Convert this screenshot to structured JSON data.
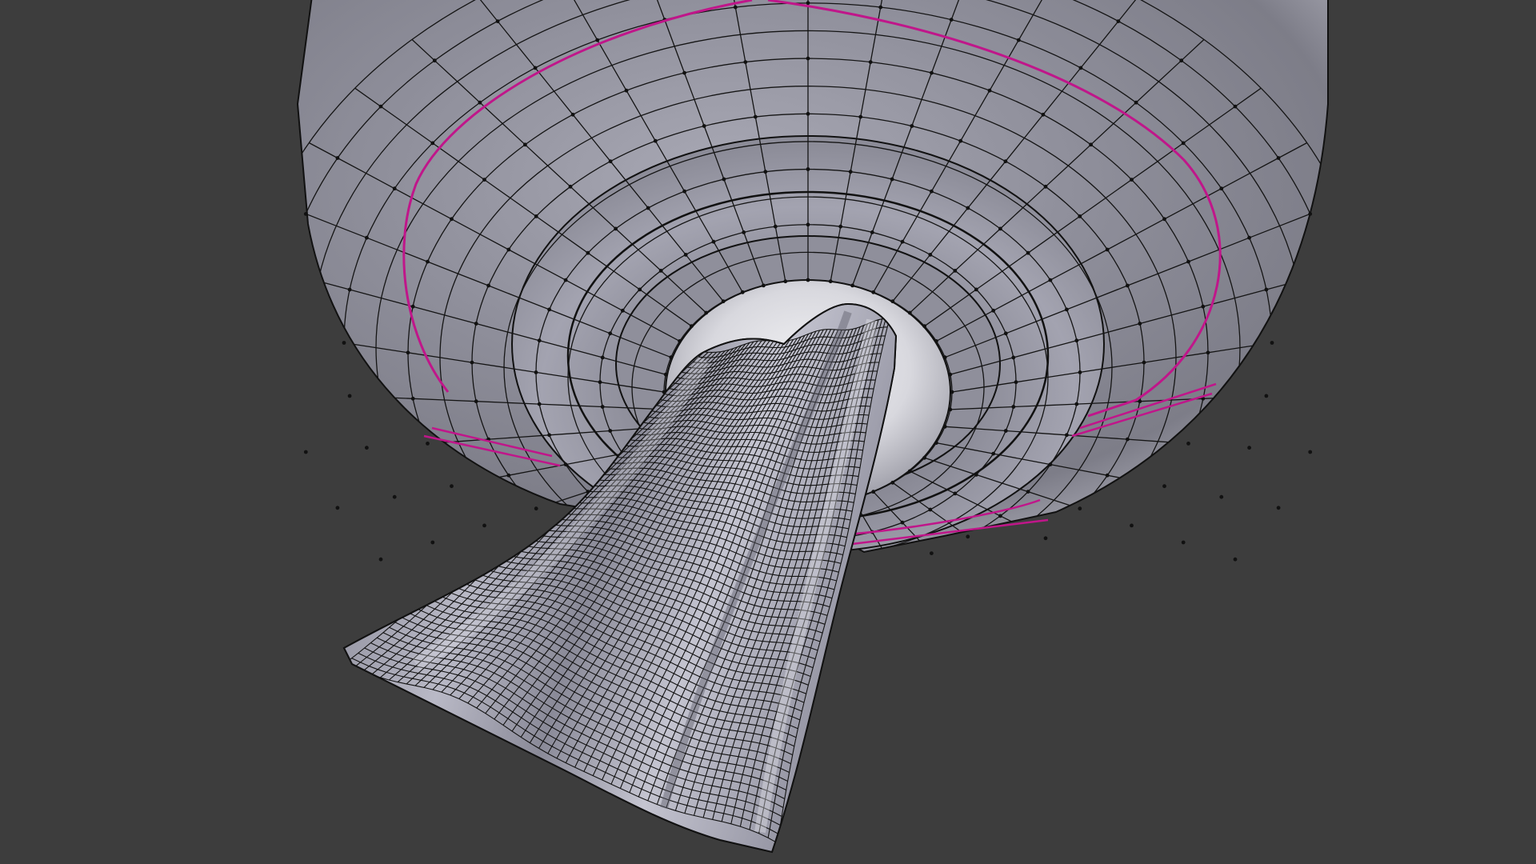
{
  "viewport": {
    "background_color": "#3d3d3d",
    "view_mode": "solid-wireframe",
    "selection_color": "#c0168a",
    "wire_color": "#101010",
    "mesh_base_color": "#8e8e9c",
    "mesh_highlight_color": "#e6e6ec"
  },
  "scene": {
    "objects": [
      {
        "name_icon": "bowl-mesh-icon",
        "kind": "bowl"
      },
      {
        "name_icon": "cloth-mesh-icon",
        "kind": "cloth"
      }
    ],
    "selected_edge_loops": 3
  }
}
